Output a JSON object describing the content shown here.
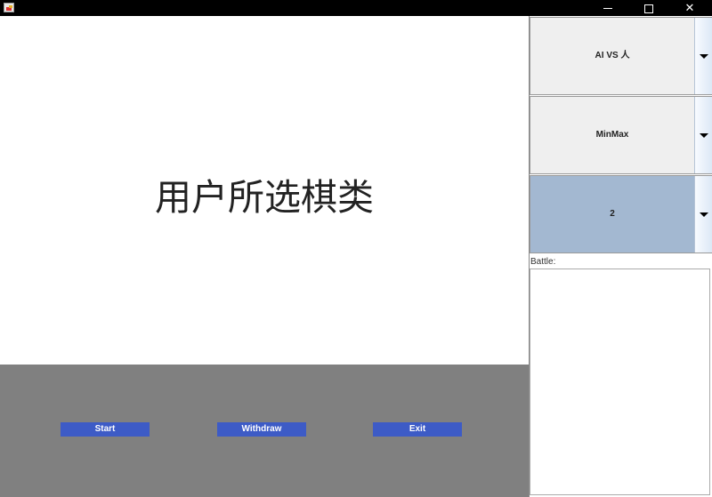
{
  "window": {
    "min": "—",
    "max": "☐",
    "close": "✕",
    "icon": "java-app-icon"
  },
  "board": {
    "title": "用户所选棋类"
  },
  "controls": {
    "start_label": "Start",
    "withdraw_label": "Withdraw",
    "exit_label": "Exit"
  },
  "side": {
    "mode": "AI VS 人",
    "algorithm": "MinMax",
    "depth": "2",
    "battle_label": "Battle:",
    "battle_log": ""
  },
  "colors": {
    "action_button": "#3d5bc6",
    "control_bar": "#808080",
    "selected_combo": "#a3b8d1"
  }
}
